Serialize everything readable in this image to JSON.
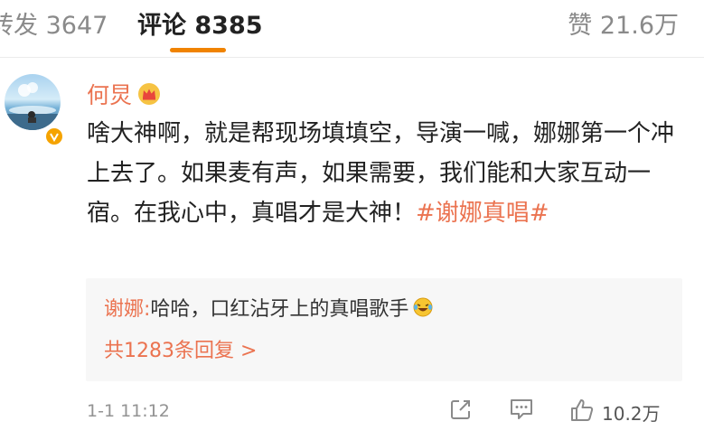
{
  "tabs": {
    "repost": "转发 3647",
    "comment": "评论 8385",
    "like": "赞 21.6万"
  },
  "colors": {
    "accent": "#eb7350",
    "tab_underline": "#f08300",
    "reply_bg": "#f7f7f7"
  },
  "comment": {
    "username": "何炅",
    "text": "啥大神啊，就是帮现场填填空，导演一喊，娜娜第一个冲上去了。如果麦有声，如果需要，我们能和大家互动一宿。在我心中，真唱才是大神！",
    "hashtag": "#谢娜真唱#",
    "reply": {
      "author": "谢娜:",
      "text": " 哈哈，口红沾牙上的真唱歌手",
      "count_label": "共1283条回复 >"
    },
    "timestamp": "1-1 11:12",
    "like_count": "10.2万"
  },
  "icons": {
    "user_badge": "crown-icon",
    "verified": "verified-v-icon",
    "emoji": "laugh-cry-emoji-icon",
    "share": "share-icon",
    "reply": "comment-bubble-icon",
    "like": "thumbs-up-icon"
  }
}
